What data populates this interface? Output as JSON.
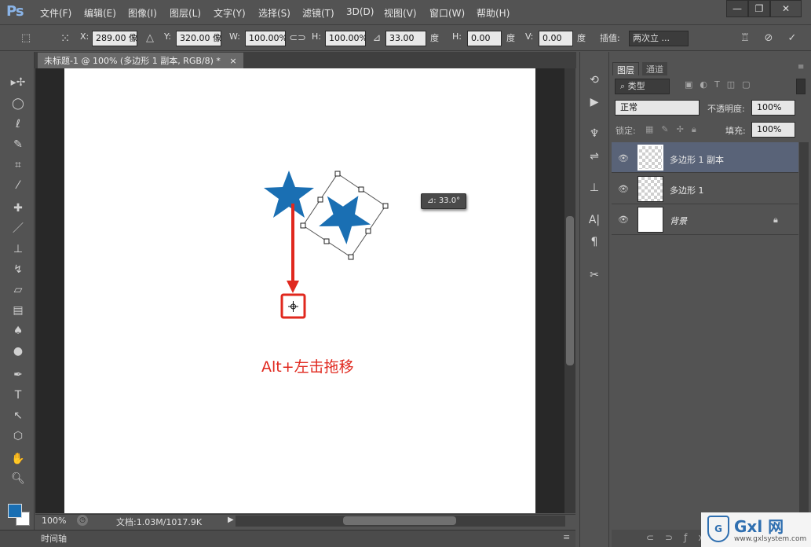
{
  "app": {
    "logo": "Ps",
    "minimize": "—",
    "restore": "❐",
    "close": "✕"
  },
  "menu": [
    "文件(F)",
    "编辑(E)",
    "图像(I)",
    "图层(L)",
    "文字(Y)",
    "选择(S)",
    "滤镜(T)",
    "3D(D)",
    "视图(V)",
    "窗口(W)",
    "帮助(H)"
  ],
  "options": {
    "x_label": "X:",
    "x_value": "289.00 像",
    "y_label": "Y:",
    "y_value": "320.00 像",
    "w_label": "W:",
    "w_value": "100.00%",
    "h_label": "H:",
    "h_value": "100.00%",
    "rotate_value": "33.00",
    "deg1": "度",
    "hskew_label": "H:",
    "hskew_value": "0.00",
    "deg2": "度",
    "vskew_label": "V:",
    "vskew_value": "0.00",
    "deg3": "度",
    "interp_label": "插值:",
    "interp_value": "两次立 ..."
  },
  "document": {
    "tab_title": "未标题-1 @ 100% (多边形 1 副本, RGB/8) *",
    "tab_close": "×"
  },
  "canvas": {
    "angle_tooltip": "⊿: 33.0°",
    "annotation": "Alt+左击拖移",
    "star_color": "#1a6fb3",
    "arrow_color": "#e0281e"
  },
  "status": {
    "zoom": "100%",
    "doc_info": "文档:1.03M/1017.9K",
    "timeline": "时间轴"
  },
  "panels": {
    "tab_layers": "图层",
    "tab_channels": "通道",
    "filter_kind": "类型",
    "blend_mode": "正常",
    "opacity_label": "不透明度:",
    "opacity_value": "100%",
    "lock_label": "锁定:",
    "fill_label": "填充:",
    "fill_value": "100%"
  },
  "layers": [
    {
      "name": "多边形 1 副本",
      "selected": true
    },
    {
      "name": "多边形 1",
      "selected": false
    },
    {
      "name": "背景",
      "selected": false,
      "locked": true
    }
  ],
  "watermark": {
    "brand": "Gxl 网",
    "url": "www.gxlsystem.com"
  }
}
